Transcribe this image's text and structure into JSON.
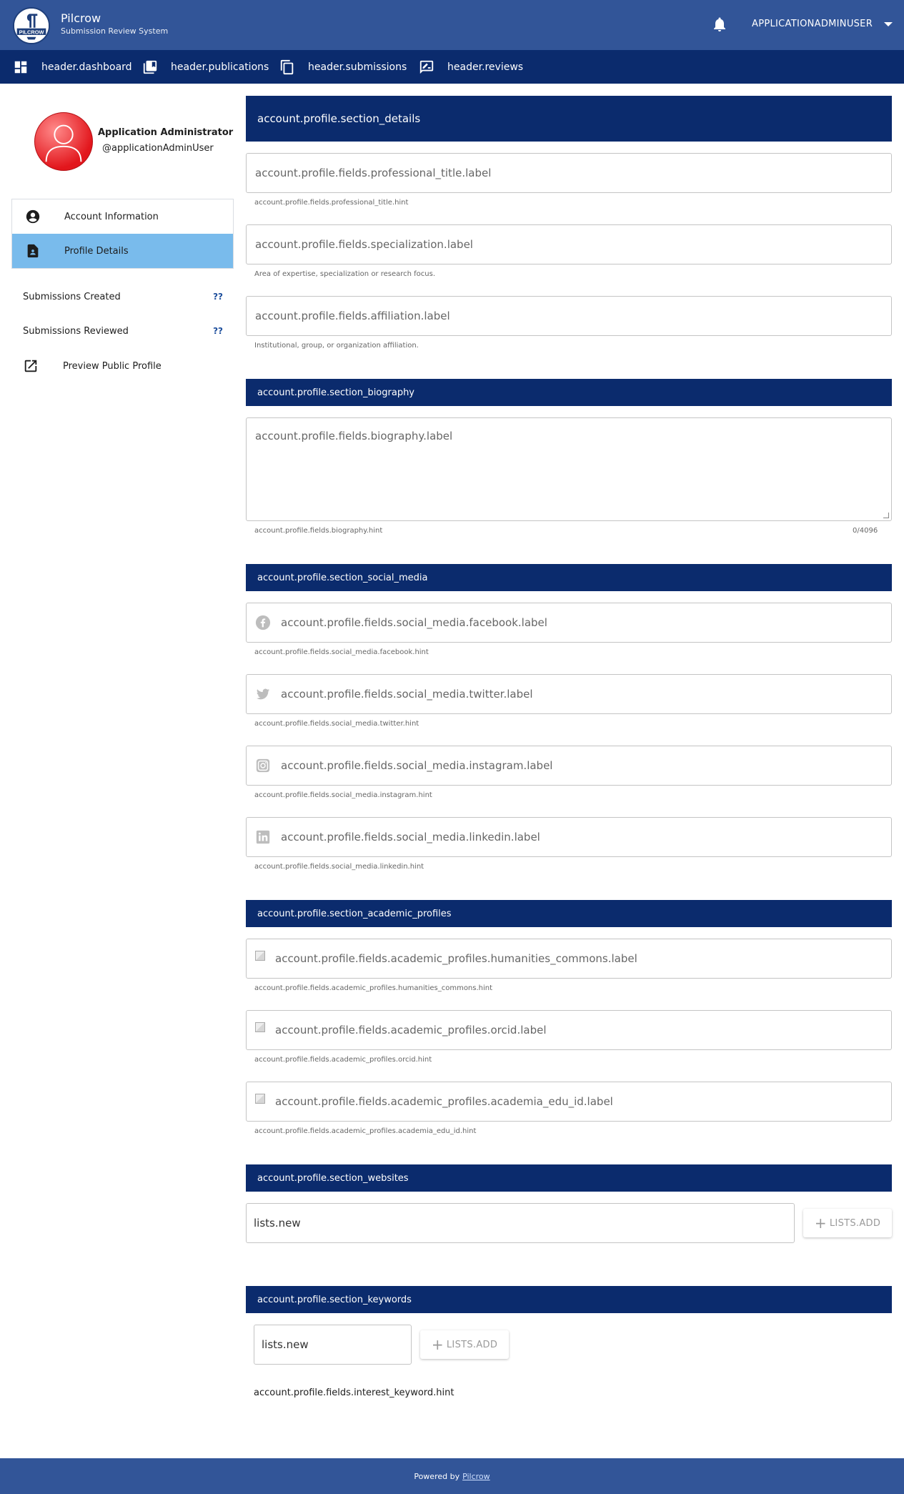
{
  "app": {
    "name": "Pilcrow",
    "subtitle": "Submission Review System",
    "logo_text": "PILCROW"
  },
  "header": {
    "user": "APPLICATIONADMINUSER",
    "nav": [
      {
        "label": "header.dashboard",
        "icon": "dashboard-icon"
      },
      {
        "label": "header.publications",
        "icon": "publications-icon"
      },
      {
        "label": "header.submissions",
        "icon": "submissions-icon"
      },
      {
        "label": "header.reviews",
        "icon": "reviews-icon"
      }
    ]
  },
  "profile": {
    "name": "Application Administrator",
    "handle": "@applicationAdminUser"
  },
  "sidebar": {
    "items": [
      {
        "label": "Account Information",
        "icon": "account-circle-icon",
        "active": false
      },
      {
        "label": "Profile Details",
        "icon": "contact-page-icon",
        "active": true
      }
    ],
    "stats": [
      {
        "label": "Submissions Created",
        "value": "??"
      },
      {
        "label": "Submissions Reviewed",
        "value": "??"
      }
    ],
    "preview_link": "Preview Public Profile"
  },
  "sections": {
    "details": "account.profile.section_details",
    "biography": "account.profile.section_biography",
    "social_media": "account.profile.section_social_media",
    "academic_profiles": "account.profile.section_academic_profiles",
    "websites": "account.profile.section_websites",
    "keywords": "account.profile.section_keywords"
  },
  "fields": {
    "professional_title": {
      "label": "account.profile.fields.professional_title.label",
      "hint": "account.profile.fields.professional_title.hint"
    },
    "specialization": {
      "label": "account.profile.fields.specialization.label",
      "hint": "Area of expertise, specialization or research focus."
    },
    "affiliation": {
      "label": "account.profile.fields.affiliation.label",
      "hint": "Institutional, group, or organization affiliation."
    },
    "biography": {
      "label": "account.profile.fields.biography.label",
      "hint": "account.profile.fields.biography.hint",
      "counter": "0/4096"
    },
    "facebook": {
      "label": "account.profile.fields.social_media.facebook.label",
      "hint": "account.profile.fields.social_media.facebook.hint"
    },
    "twitter": {
      "label": "account.profile.fields.social_media.twitter.label",
      "hint": "account.profile.fields.social_media.twitter.hint"
    },
    "instagram": {
      "label": "account.profile.fields.social_media.instagram.label",
      "hint": "account.profile.fields.social_media.instagram.hint"
    },
    "linkedin": {
      "label": "account.profile.fields.social_media.linkedin.label",
      "hint": "account.profile.fields.social_media.linkedin.hint"
    },
    "humanities_commons": {
      "label": "account.profile.fields.academic_profiles.humanities_commons.label",
      "hint": "account.profile.fields.academic_profiles.humanities_commons.hint"
    },
    "orcid": {
      "label": "account.profile.fields.academic_profiles.orcid.label",
      "hint": "account.profile.fields.academic_profiles.orcid.hint"
    },
    "academia_edu_id": {
      "label": "account.profile.fields.academic_profiles.academia_edu_id.label",
      "hint": "account.profile.fields.academic_profiles.academia_edu_id.hint"
    }
  },
  "websites": {
    "placeholder": "lists.new",
    "add_label": "LISTS.ADD"
  },
  "keywords": {
    "placeholder": "lists.new",
    "add_label": "LISTS.ADD",
    "hint": "account.profile.fields.interest_keyword.hint"
  },
  "footer": {
    "prefix": "Powered by",
    "link": "Pilcrow"
  },
  "colors": {
    "topbar": "#325598",
    "navbar": "#0b2b6d",
    "active_item": "#79bbec",
    "avatar": "#e2161c"
  }
}
